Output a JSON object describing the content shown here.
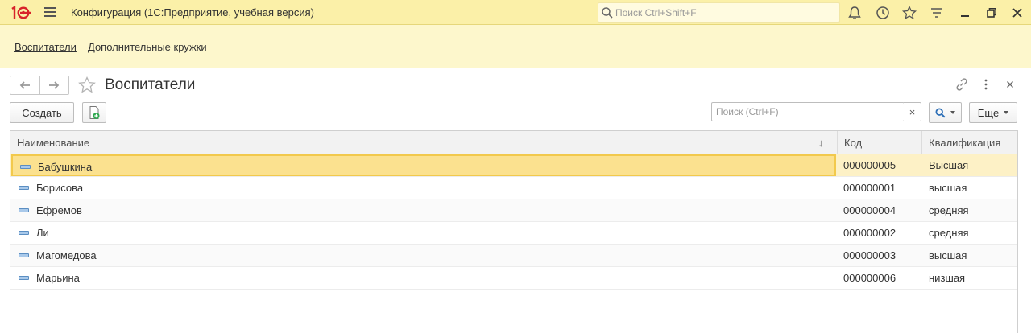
{
  "app": {
    "title": "Конфигурация  (1С:Предприятие, учебная версия)",
    "search_placeholder": "Поиск Ctrl+Shift+F"
  },
  "sections": {
    "items": [
      {
        "label": "Воспитатели",
        "active": true
      },
      {
        "label": "Дополнительные кружки",
        "active": false
      }
    ]
  },
  "form": {
    "title": "Воспитатели",
    "create_label": "Создать",
    "search_placeholder": "Поиск (Ctrl+F)",
    "clear_label": "×",
    "more_label": "Еще"
  },
  "table": {
    "columns": {
      "name": "Наименование",
      "code": "Код",
      "qualification": "Квалификация"
    },
    "sort_indicator": "↓",
    "rows": [
      {
        "name": "Бабушкина",
        "code": "000000005",
        "qualification": "Высшая"
      },
      {
        "name": "Борисова",
        "code": "000000001",
        "qualification": "высшая"
      },
      {
        "name": "Ефремов",
        "code": "000000004",
        "qualification": "средняя"
      },
      {
        "name": "Ли",
        "code": "000000002",
        "qualification": "средняя"
      },
      {
        "name": "Магомедова",
        "code": "000000003",
        "qualification": "высшая"
      },
      {
        "name": "Марьина",
        "code": "000000006",
        "qualification": "низшая"
      }
    ]
  },
  "colors": {
    "titlebar_bg": "#fbf0a8",
    "sections_bg": "#fdf7cc",
    "selected_row": "#fbe18f",
    "brand_red": "#d8232a"
  },
  "icons": {
    "titlebar": [
      "bell-icon",
      "history-icon",
      "star-icon",
      "settings-lines-icon",
      "restore-icon",
      "close-icon"
    ],
    "form_header": [
      "link-icon",
      "more-vert-icon",
      "close-icon"
    ]
  }
}
